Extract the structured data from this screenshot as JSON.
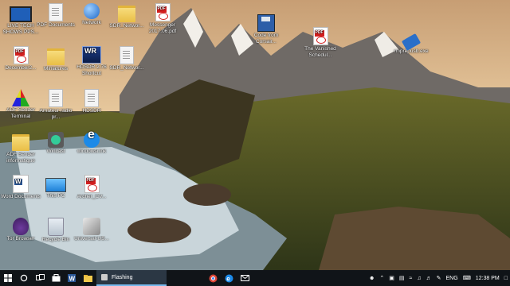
{
  "desktop": {
    "icons": [
      {
        "id": "live-tech-shows",
        "label": "LIVE TECH SHOWS PPS...",
        "glyph": "g-monitor",
        "icon": "monitor-icon"
      },
      {
        "id": "pdf-documents",
        "label": "PDF Documents",
        "glyph": "g-file",
        "icon": "document-icon"
      },
      {
        "id": "network",
        "label": "Network",
        "glyph": "g-net",
        "icon": "network-icon"
      },
      {
        "id": "sdr-network-1",
        "label": "SDR_Networ...",
        "glyph": "g-folder",
        "icon": "folder-icon"
      },
      {
        "id": "messenger-pdf",
        "label": "Messenger 2017.06.pdf",
        "glyph": "g-pdf",
        "icon": "pdf-icon"
      },
      {
        "id": "december-pdf",
        "label": "December2...",
        "glyph": "g-pdf",
        "icon": "pdf-icon"
      },
      {
        "id": "miniatures",
        "label": "Miniatures",
        "glyph": "g-folder",
        "icon": "folder-icon"
      },
      {
        "id": "hdsdr-shortcut",
        "label": "HDSDR 2.76 Shortcut",
        "glyph": "g-wr",
        "icon": "wr-icon"
      },
      {
        "id": "sdr-network-2",
        "label": "SDR_Networ...",
        "glyph": "g-file",
        "icon": "document-icon"
      },
      {
        "id": "adf-sender",
        "label": "ADF Sender Terminal",
        "glyph": "g-adf",
        "icon": "adf-icon"
      },
      {
        "id": "amateur-radio",
        "label": "Amateur radio pr...",
        "glyph": "g-file",
        "icon": "document-icon"
      },
      {
        "id": "hdsdr",
        "label": "HDSDR",
        "glyph": "g-file",
        "icon": "document-icon"
      },
      {
        "id": "adf-informatique",
        "label": "ADF Sender informatique",
        "glyph": "g-folder",
        "icon": "folder-icon"
      },
      {
        "id": "wincast",
        "label": "Wincast",
        "glyph": "g-dev",
        "icon": "device-icon"
      },
      {
        "id": "windows-ie",
        "label": "windowsi.lnk",
        "glyph": "g-ie",
        "icon": "internet-explorer-icon"
      },
      {
        "id": "word-documents",
        "label": "Word Documents",
        "glyph": "g-word",
        "icon": "word-icon"
      },
      {
        "id": "this-pc",
        "label": "This PC",
        "glyph": "g-pc",
        "icon": "computer-icon"
      },
      {
        "id": "archer-cv",
        "label": "Archer_CV...",
        "glyph": "g-pdf",
        "icon": "pdf-icon"
      },
      {
        "id": "tor-browser",
        "label": "Tor Browser",
        "glyph": "g-tor",
        "icon": "tor-icon"
      },
      {
        "id": "recycle-bin",
        "label": "Recycle Bin",
        "glyph": "g-bin",
        "icon": "recycle-bin-icon"
      },
      {
        "id": "universal-usb",
        "label": "Universal-US...",
        "glyph": "g-uni",
        "icon": "installer-icon"
      },
      {
        "id": "code-from-corsair",
        "label": "Code from Corsair...",
        "glyph": "g-floppy",
        "icon": "floppy-icon"
      },
      {
        "id": "the-vanished-pdf",
        "label": "The Vanished Schedul...",
        "glyph": "g-pdf",
        "icon": "pdf-icon"
      },
      {
        "id": "usb-tool",
        "label": "rmprepusb.exe",
        "glyph": "g-usb",
        "icon": "usb-icon"
      }
    ]
  },
  "taskbar": {
    "active_app_label": "Flashing",
    "tray": {
      "language": "ENG",
      "time": "12:38 PM"
    },
    "colors": {
      "background": "#101418",
      "accent": "#76b9ed"
    }
  }
}
